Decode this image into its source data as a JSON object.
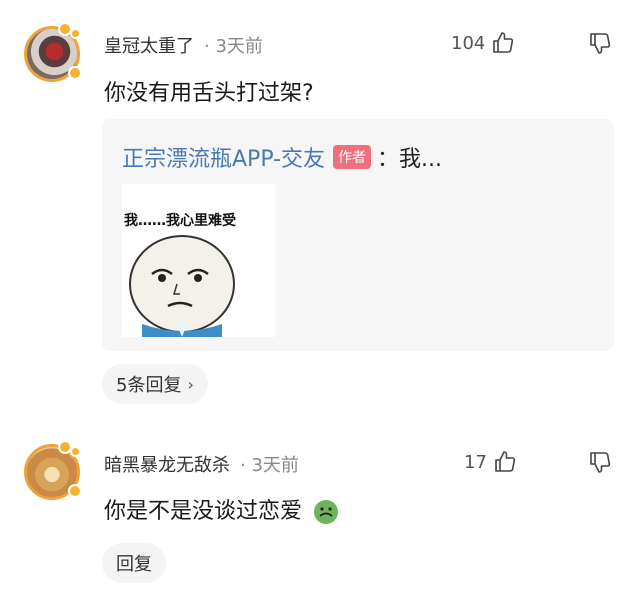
{
  "comments": [
    {
      "user": "皇冠太重了",
      "time": "· 3天前",
      "likes": "104",
      "text": "你没有用舌头打过架?",
      "quote": {
        "author": "正宗漂流瓶APP-交友",
        "author_tag": "作者",
        "text": "：我...",
        "sticker_caption": "我……我心里难受"
      },
      "reply_label": "5条回复",
      "reply_icon": "chevron-right-icon"
    },
    {
      "user": "暗黑暴龙无敌杀",
      "time": "· 3天前",
      "likes": "17",
      "text": "你是不是没谈过恋爱",
      "emoji": "nauseated-face-emoji",
      "reply_label": "回复"
    }
  ],
  "icons": {
    "like": "thumbs-up-icon",
    "dislike": "thumbs-down-icon"
  },
  "colors": {
    "author_link": "#4a78b5",
    "author_tag": "#f26d7d",
    "avatar_ring": "#f0a23a"
  }
}
